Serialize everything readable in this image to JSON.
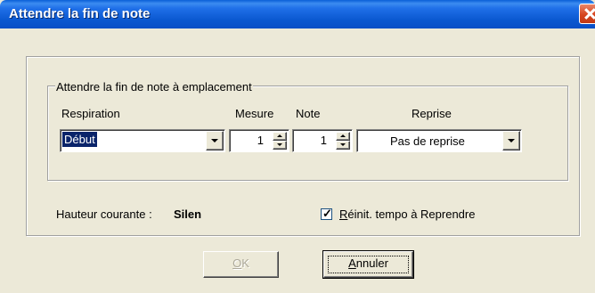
{
  "window": {
    "title": "Attendre la fin de note"
  },
  "group": {
    "legend": "Attendre la fin de note à emplacement"
  },
  "columns": {
    "respiration": "Respiration",
    "mesure": "Mesure",
    "note": "Note",
    "reprise": "Reprise"
  },
  "respiration_select": {
    "value": "Début"
  },
  "mesure_spinner": {
    "value": "1"
  },
  "note_spinner": {
    "value": "1"
  },
  "reprise_select": {
    "value": "Pas de reprise"
  },
  "status": {
    "label": "Hauteur courante :",
    "value": "Silen"
  },
  "reset_tempo": {
    "label": "Réinit. tempo à Reprendre",
    "checked": true
  },
  "buttons": {
    "ok": "OK",
    "cancel": "Annuler"
  }
}
